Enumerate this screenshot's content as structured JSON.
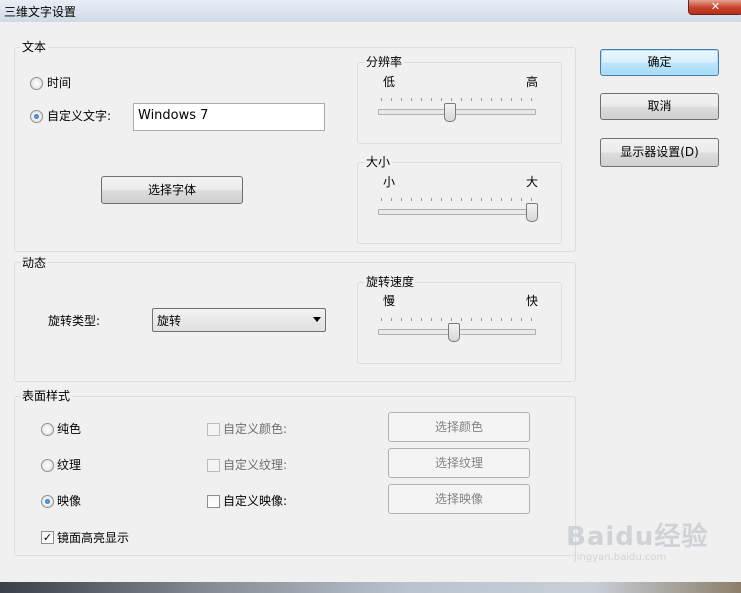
{
  "window": {
    "title": "三维文字设置",
    "close": "✕"
  },
  "buttons": {
    "ok": "确定",
    "cancel": "取消",
    "display": "显示器设置(D)"
  },
  "text_group": {
    "label": "文本",
    "time_label": "时间",
    "custom_label": "自定义文字:",
    "custom_value": "Windows 7",
    "font_button": "选择字体",
    "selected": "custom"
  },
  "resolution": {
    "label": "分辨率",
    "min": "低",
    "max": "高",
    "level": 0.5
  },
  "size": {
    "label": "大小",
    "min": "小",
    "max": "大",
    "level": 1.0
  },
  "motion_group": {
    "label": "动态",
    "rotate_type_label": "旋转类型:",
    "rotate_type_value": "旋转",
    "speed": {
      "label": "旋转速度",
      "min": "慢",
      "max": "快",
      "level": 0.5
    }
  },
  "surface_group": {
    "label": "表面样式",
    "options": [
      {
        "label": "纯色",
        "checked": false,
        "custom_label": "自定义颜色:",
        "custom_enabled": false,
        "button": "选择颜色"
      },
      {
        "label": "纹理",
        "checked": false,
        "custom_label": "自定义纹理:",
        "custom_enabled": false,
        "button": "选择纹理"
      },
      {
        "label": "映像",
        "checked": true,
        "custom_label": "自定义映像:",
        "custom_enabled": true,
        "button": "选择映像"
      }
    ],
    "mirror_label": "镜面高亮显示",
    "mirror_checked": true
  },
  "watermark": {
    "brand": "Baidu经验",
    "url": "jingyan.baidu.com"
  }
}
